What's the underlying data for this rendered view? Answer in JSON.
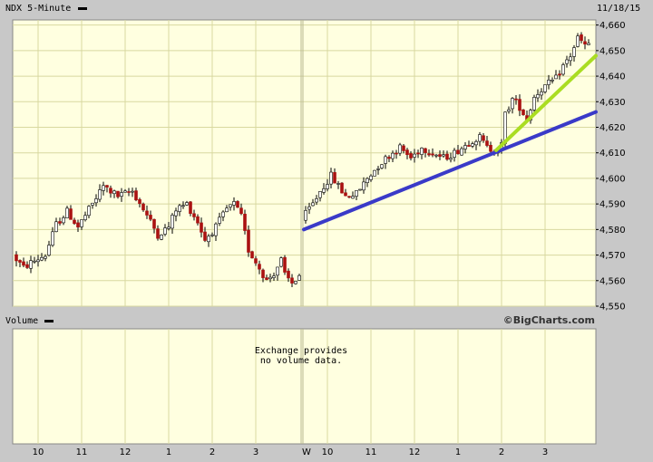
{
  "header": {
    "symbol_title": "NDX 5-Minute",
    "date": "11/18/15"
  },
  "volume_panel": {
    "title": "Volume",
    "message_line1": "Exchange provides",
    "message_line2": "no volume data."
  },
  "branding": {
    "text": "©BigCharts.com"
  },
  "colors": {
    "background": "#c8c8c8",
    "plot_bg": "#ffffe0",
    "grid": "#d8d8a0",
    "up_candle": "#ffffff",
    "down_candle": "#aa1111",
    "trendline_blue": "#3a3ac8",
    "trendline_green": "#aadd22"
  },
  "chart_data": {
    "type": "candlestick",
    "title": "NDX 5-Minute",
    "ylim": [
      4550,
      4662
    ],
    "y_ticks": [
      4550,
      4560,
      4570,
      4580,
      4590,
      4600,
      4610,
      4620,
      4630,
      4640,
      4650,
      4660
    ],
    "y_tick_labels": [
      "4,550",
      "4,560",
      "4,570",
      "4,580",
      "4,590",
      "4,600",
      "4,610",
      "4,620",
      "4,630",
      "4,640",
      "4,650",
      "4,660"
    ],
    "x_tick_labels": [
      {
        "day": 1,
        "time": "10"
      },
      {
        "day": 1,
        "time": "11"
      },
      {
        "day": 1,
        "time": "12"
      },
      {
        "day": 1,
        "time": "1"
      },
      {
        "day": 1,
        "time": "2"
      },
      {
        "day": 1,
        "time": "3"
      },
      {
        "day": 2,
        "time": "W"
      },
      {
        "day": 2,
        "time": "10"
      },
      {
        "day": 2,
        "time": "11"
      },
      {
        "day": 2,
        "time": "12"
      },
      {
        "day": 2,
        "time": "1"
      },
      {
        "day": 2,
        "time": "2"
      },
      {
        "day": 2,
        "time": "3"
      }
    ],
    "day1_close_anchor": 4567,
    "day1_keypoints": [
      [
        0,
        4570
      ],
      [
        3,
        4565
      ],
      [
        5,
        4567
      ],
      [
        9,
        4570
      ],
      [
        12,
        4582
      ],
      [
        15,
        4587
      ],
      [
        18,
        4581
      ],
      [
        22,
        4590
      ],
      [
        25,
        4597
      ],
      [
        29,
        4593
      ],
      [
        31,
        4594
      ],
      [
        33,
        4595
      ],
      [
        36,
        4588
      ],
      [
        40,
        4578
      ],
      [
        43,
        4581
      ],
      [
        45,
        4588
      ],
      [
        48,
        4590
      ],
      [
        51,
        4583
      ],
      [
        53,
        4576
      ],
      [
        56,
        4581
      ],
      [
        59,
        4588
      ],
      [
        61,
        4590
      ],
      [
        63,
        4585
      ],
      [
        65,
        4572
      ],
      [
        68,
        4565
      ],
      [
        70,
        4560
      ],
      [
        72,
        4563
      ],
      [
        74,
        4568
      ],
      [
        75,
        4562
      ],
      [
        77,
        4559
      ],
      [
        79,
        4562
      ],
      [
        81,
        4569
      ],
      [
        83,
        4567
      ],
      [
        85,
        4568
      ]
    ],
    "day2_keypoints": [
      [
        0,
        4584
      ],
      [
        3,
        4590
      ],
      [
        5,
        4595
      ],
      [
        8,
        4601
      ],
      [
        10,
        4597
      ],
      [
        12,
        4593
      ],
      [
        15,
        4594
      ],
      [
        18,
        4600
      ],
      [
        21,
        4605
      ],
      [
        24,
        4609
      ],
      [
        27,
        4612
      ],
      [
        30,
        4608
      ],
      [
        33,
        4612
      ],
      [
        36,
        4610
      ],
      [
        39,
        4608
      ],
      [
        42,
        4610
      ],
      [
        45,
        4613
      ],
      [
        47,
        4615
      ],
      [
        49,
        4616
      ],
      [
        51,
        4612
      ],
      [
        53,
        4611
      ],
      [
        55,
        4613
      ],
      [
        56,
        4625
      ],
      [
        58,
        4631
      ],
      [
        60,
        4628
      ],
      [
        62,
        4623
      ],
      [
        64,
        4632
      ],
      [
        66,
        4635
      ],
      [
        68,
        4637
      ],
      [
        70,
        4639
      ],
      [
        72,
        4644
      ],
      [
        74,
        4648
      ],
      [
        76,
        4655
      ],
      [
        78,
        4652
      ]
    ],
    "trendlines": [
      {
        "color": "blue",
        "start": {
          "day": 2,
          "bar": 0,
          "value": 4580
        },
        "end": {
          "day": 2,
          "bar": 80,
          "value": 4626
        }
      },
      {
        "color": "green",
        "start": {
          "day": 2,
          "bar": 53,
          "value": 4611
        },
        "end": {
          "day": 2,
          "bar": 80,
          "value": 4648
        }
      }
    ],
    "grid": true
  }
}
